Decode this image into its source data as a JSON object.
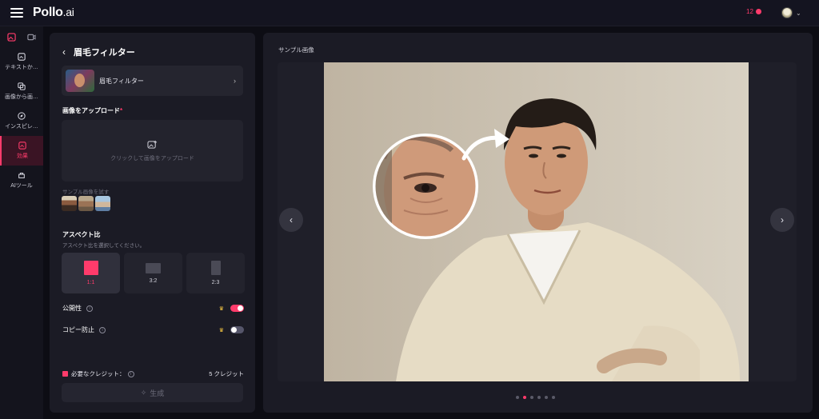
{
  "topbar": {
    "logo_main": "Pollo",
    "logo_suffix": ".ai",
    "credits": "12"
  },
  "sidebar": {
    "items": [
      {
        "label": "テキストか…",
        "icon": "text-to-image-icon"
      },
      {
        "label": "画像から画…",
        "icon": "image-to-image-icon"
      },
      {
        "label": "インスピレ…",
        "icon": "compass-icon"
      },
      {
        "label": "効果",
        "icon": "effects-icon"
      },
      {
        "label": "AIツール",
        "icon": "ai-tools-icon"
      }
    ]
  },
  "panel": {
    "title": "眉毛フィルター",
    "filter_name": "眉毛フィルター",
    "upload_label": "画像をアップロード",
    "required_mark": "*",
    "dropzone_text": "クリックして画像をアップロード",
    "samples_label": "サンプル画像を試す",
    "aspect_label": "アスペクト比",
    "aspect_desc": "アスペクト比を選択してください。",
    "aspects": [
      {
        "label": "1:1",
        "selected": true
      },
      {
        "label": "3:2",
        "selected": false
      },
      {
        "label": "2:3",
        "selected": false
      }
    ],
    "public_label": "公開性",
    "public_on": true,
    "copy_protect_label": "コピー防止",
    "copy_protect_on": false,
    "credits_required_label": "必要なクレジット：",
    "credits_required_value": "5 クレジット",
    "generate_label": "生成"
  },
  "preview": {
    "title": "サンプル画像",
    "dot_count": 6,
    "active_dot": 1
  },
  "colors": {
    "accent": "#ff3b6b",
    "background": "#0d0d14",
    "panel": "#1b1b25"
  }
}
